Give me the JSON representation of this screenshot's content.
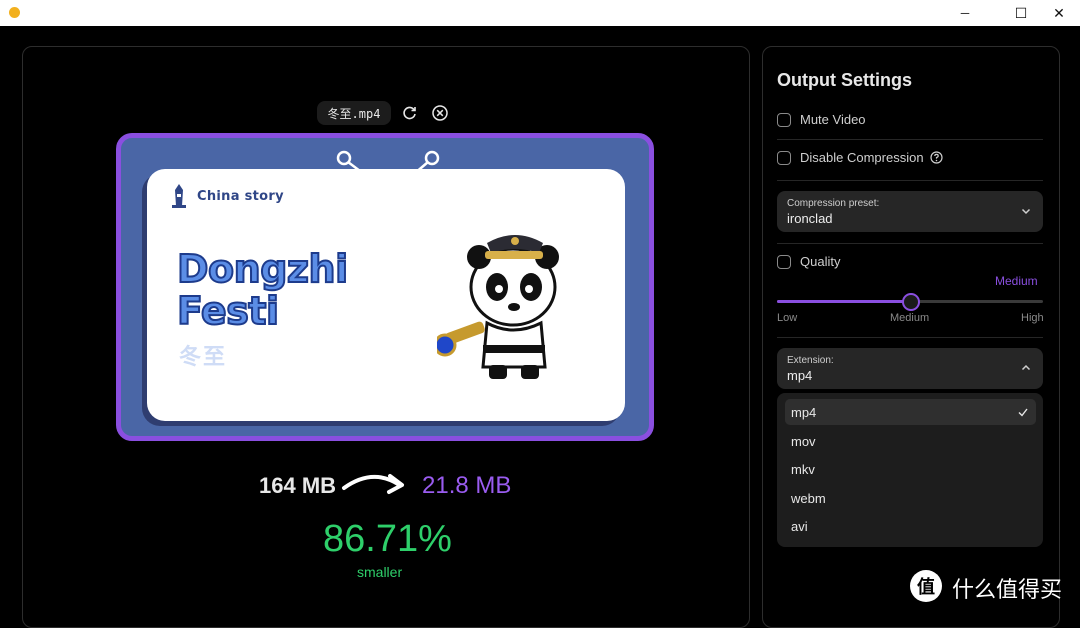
{
  "window": {
    "minimize_glyph": "─",
    "maximize_glyph": "☐",
    "close_glyph": "✕"
  },
  "preview": {
    "file_name": "冬至.mp4",
    "card_brand": "China story",
    "card_title_line1": "Dongzhi",
    "card_title_line2": "Festi",
    "card_subtitle": "冬至"
  },
  "result": {
    "original_size": "164 MB",
    "compressed_size": "21.8 MB",
    "reduction_percent": "86.71%",
    "reduction_label": "smaller"
  },
  "settings": {
    "title": "Output Settings",
    "mute_video_label": "Mute Video",
    "mute_video_checked": false,
    "disable_compression_label": "Disable Compression",
    "disable_compression_checked": false,
    "compression_preset": {
      "label": "Compression preset:",
      "value": "ironclad"
    },
    "quality_label": "Quality",
    "quality_checked": false,
    "quality_level": "Medium",
    "quality_slider_value": 0.5,
    "quality_ticks": {
      "low": "Low",
      "medium": "Medium",
      "high": "High"
    },
    "extension": {
      "label": "Extension:",
      "value": "mp4",
      "options": [
        "mp4",
        "mov",
        "mkv",
        "webm",
        "avi"
      ]
    }
  },
  "watermark": {
    "logo_glyph": "值",
    "text": "什么值得买"
  },
  "colors": {
    "accent": "#8a4fe0",
    "success": "#2ecf6a",
    "preview_frame": "#8a4fe0"
  }
}
